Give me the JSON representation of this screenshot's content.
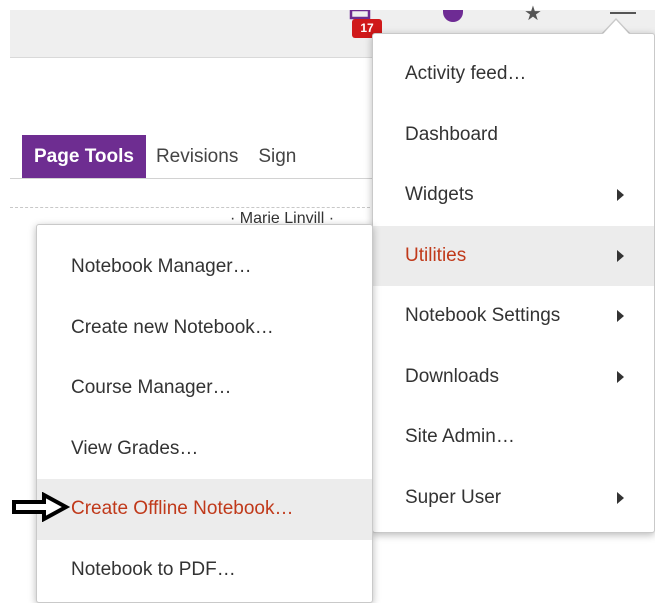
{
  "topbar": {
    "notification_count": "17",
    "icons": [
      "notification-icon",
      "purple-circle-icon",
      "star-icon",
      "user-icon"
    ]
  },
  "tabs": [
    {
      "label": "Page Tools",
      "active": true
    },
    {
      "label": "Revisions",
      "active": false
    },
    {
      "label": "Sign",
      "active": false
    }
  ],
  "page": {
    "author": "Marie Linvill"
  },
  "main_menu": {
    "items": [
      {
        "label": "Activity feed…",
        "has_submenu": false
      },
      {
        "label": "Dashboard",
        "has_submenu": false
      },
      {
        "label": "Widgets",
        "has_submenu": true
      },
      {
        "label": "Utilities",
        "has_submenu": true,
        "highlighted": true
      },
      {
        "label": "Notebook Settings",
        "has_submenu": true
      },
      {
        "label": "Downloads",
        "has_submenu": true
      },
      {
        "label": "Site Admin…",
        "has_submenu": false
      },
      {
        "label": "Super User",
        "has_submenu": true
      }
    ]
  },
  "utilities_submenu": {
    "items": [
      {
        "label": "Notebook Manager…"
      },
      {
        "label": "Create new Notebook…"
      },
      {
        "label": "Course Manager…"
      },
      {
        "label": "View Grades…"
      },
      {
        "label": "Create Offline Notebook…",
        "highlighted": true
      },
      {
        "label": "Notebook to PDF…"
      }
    ]
  },
  "colors": {
    "brand_purple": "#6e2d91",
    "highlight_text": "#c0391a",
    "badge_red": "#d0191a",
    "menu_hover": "#ececec"
  }
}
